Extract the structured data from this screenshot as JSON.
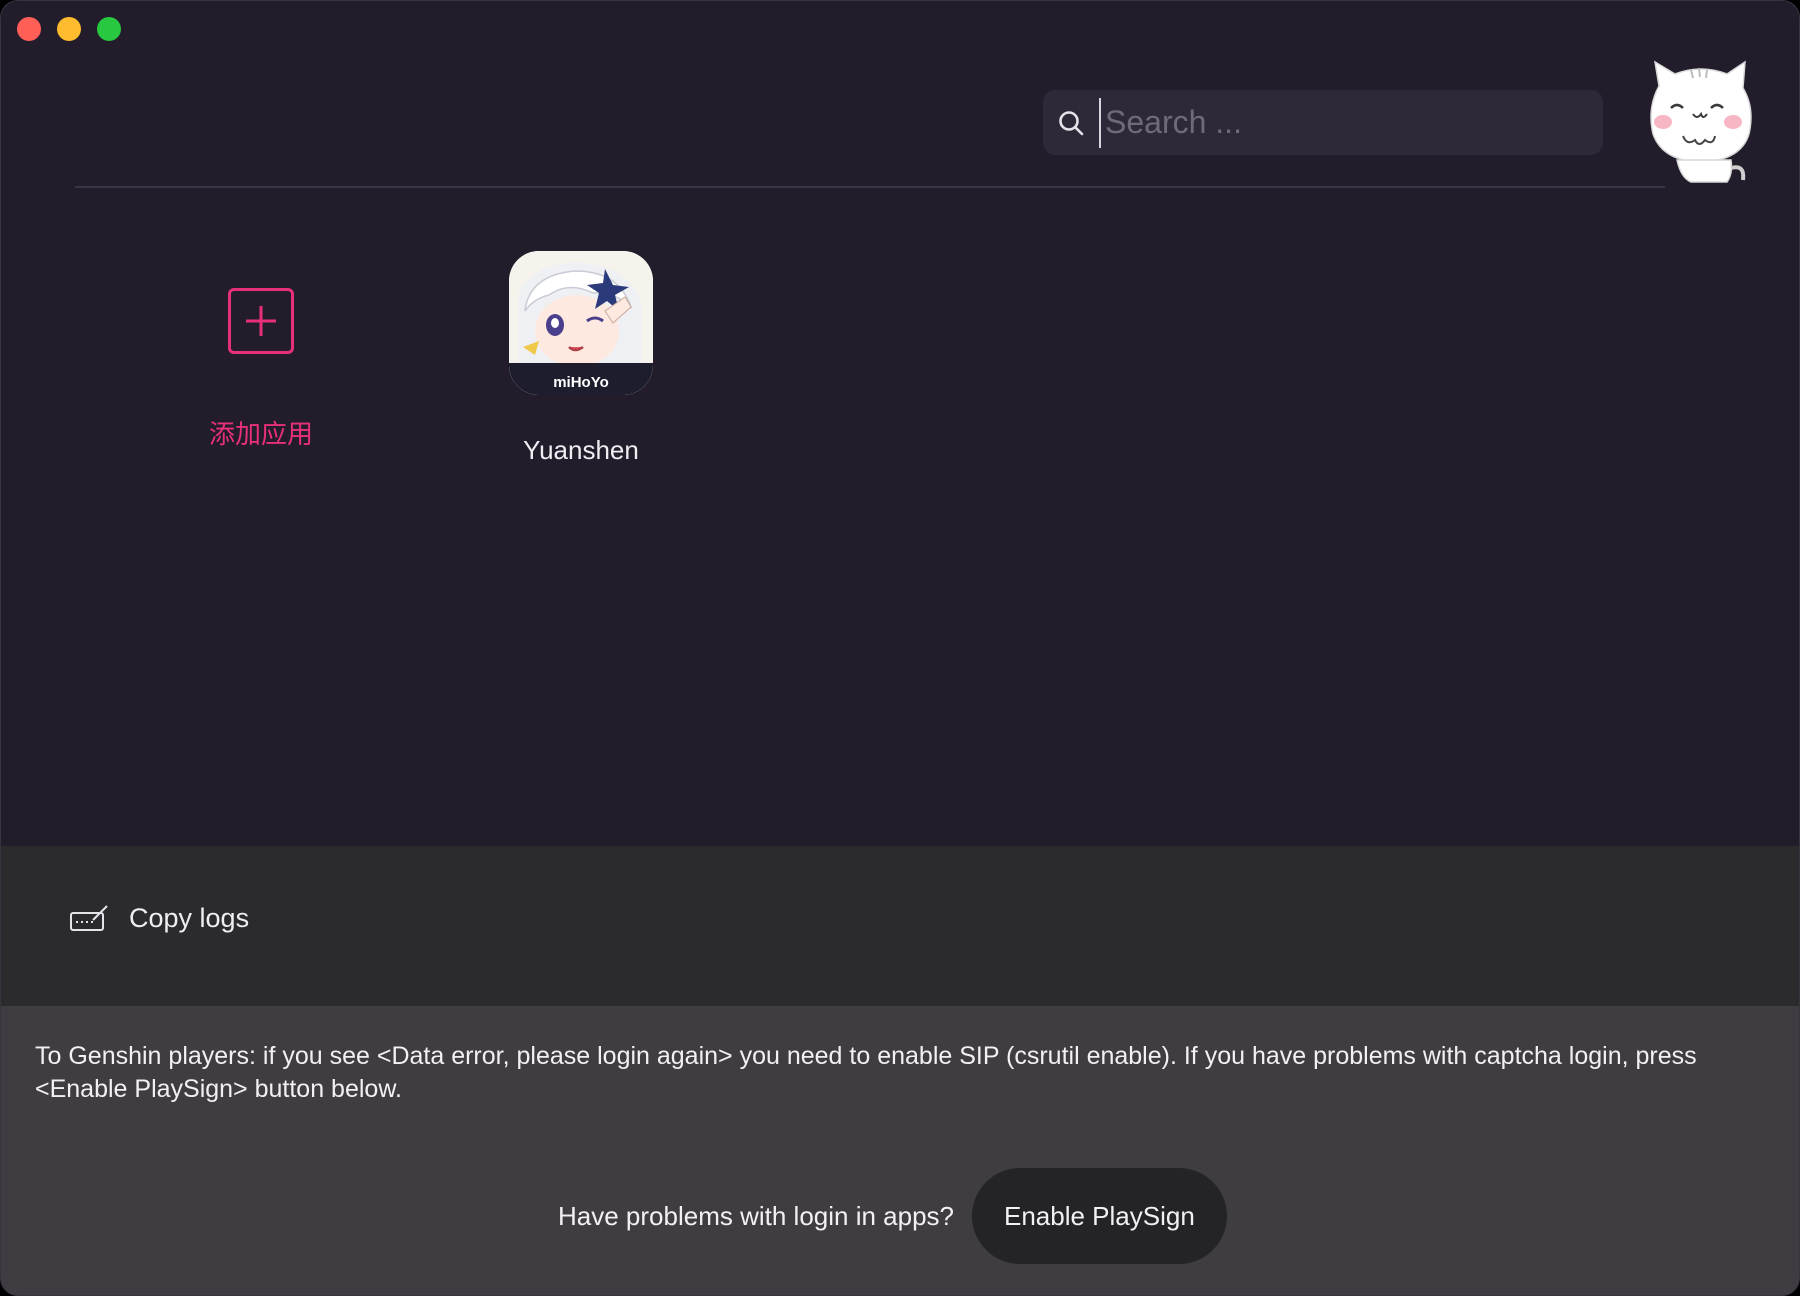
{
  "window": {
    "controls": [
      "close",
      "minimize",
      "maximize"
    ]
  },
  "search": {
    "placeholder": "Search ...",
    "value": "",
    "icon": "search-icon"
  },
  "apps": {
    "add_label": "添加应用",
    "items": [
      {
        "name": "Yuanshen",
        "icon_text": "miHoYo"
      }
    ]
  },
  "logs": {
    "copy_label": "Copy logs",
    "icon": "keyboard-pen-icon"
  },
  "notice": {
    "text": "To Genshin players: if you see <Data error, please login again> you need to enable SIP (csrutil enable). If you have problems with captcha login, press <Enable PlaySign> button below.",
    "question": "Have problems with login in apps?",
    "button_label": "Enable PlaySign"
  },
  "colors": {
    "background": "#231d2b",
    "accent": "#e8307a",
    "logs_bar": "#2b2a2d",
    "notice_panel": "#3f3d41"
  }
}
